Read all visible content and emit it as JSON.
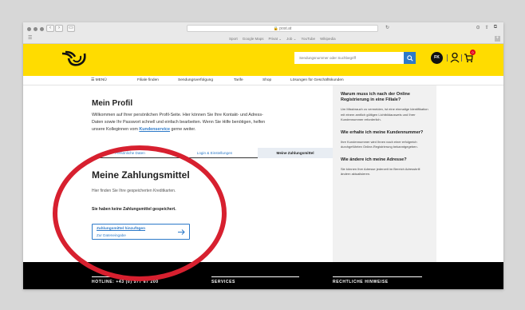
{
  "browser": {
    "url": "post.at",
    "bookmarks": [
      "Sport",
      "Google Maps",
      "Privat",
      "Job",
      "YouTube",
      "Wikipedia"
    ]
  },
  "header": {
    "search_placeholder": "Sendungsnummer oder Suchbegriff",
    "avatar_initials": "FK",
    "cart_count": "0",
    "brand_color": "#ffdc00",
    "accent_color": "#2d7ac9"
  },
  "nav": {
    "menu": "MENÜ",
    "items": [
      "Filiale finden",
      "Sendungsverfolgung",
      "Tarife",
      "Shop",
      "Lösungen für Geschäftskunden"
    ]
  },
  "profile": {
    "title": "Mein Profil",
    "intro_line1": "Willkommen auf Ihrer persönlichen Profil-Seite. Hier können Sie Ihre Kontakt- und Adress-",
    "intro_line2": "Daten sowie Ihr Passwort schnell und einfach bearbeiten. Wenn Sie Hilfe benötigen, helfen",
    "intro_line3_pre": "unsere Kolleginnen vom",
    "intro_link": "Kundenservice",
    "intro_line3_post": "gerne weiter."
  },
  "tabs": [
    "Persönliche Daten",
    "Login & Einstellungen",
    "Meine Zahlungsmittel"
  ],
  "payment": {
    "title": "Meine Zahlungsmittel",
    "description": "Hier finden Sie Ihre gespeicherten Kreditkarten.",
    "empty_message": "Sie haben keine Zahlungsmittel gespeichert.",
    "add_label": "Zahlungsmittel hinzufügen",
    "add_sub": "Zur Dateneingabe"
  },
  "faq": [
    {
      "q": "Warum muss ich nach der Online Registrierung in eine Filiale?",
      "a": "Um Missbrauch zu vermeiden, ist eine einmalige Identifikation mit einem amtlich gültigen Lichtbildausweis und Ihrer Kundennummer erforderlich."
    },
    {
      "q": "Wie erhalte ich meine Kundennummer?",
      "a": "Ihre Kundennummer wird Ihnen nach einer erfolgreich durchgeführten Online-Registrierung bekanntgegeben."
    },
    {
      "q": "Wie ändere ich meine Adresse?",
      "a": "Sie können Ihre Adresse jederzeit im Bereich Adressbrill ändern aktualisieren."
    }
  ],
  "footer": {
    "col1": "HOTLINE: +43 (0) 577 67 200",
    "col2": "SERVICES",
    "col3": "RECHTLICHE HINWEISE"
  },
  "annotation_color": "#d7202f"
}
